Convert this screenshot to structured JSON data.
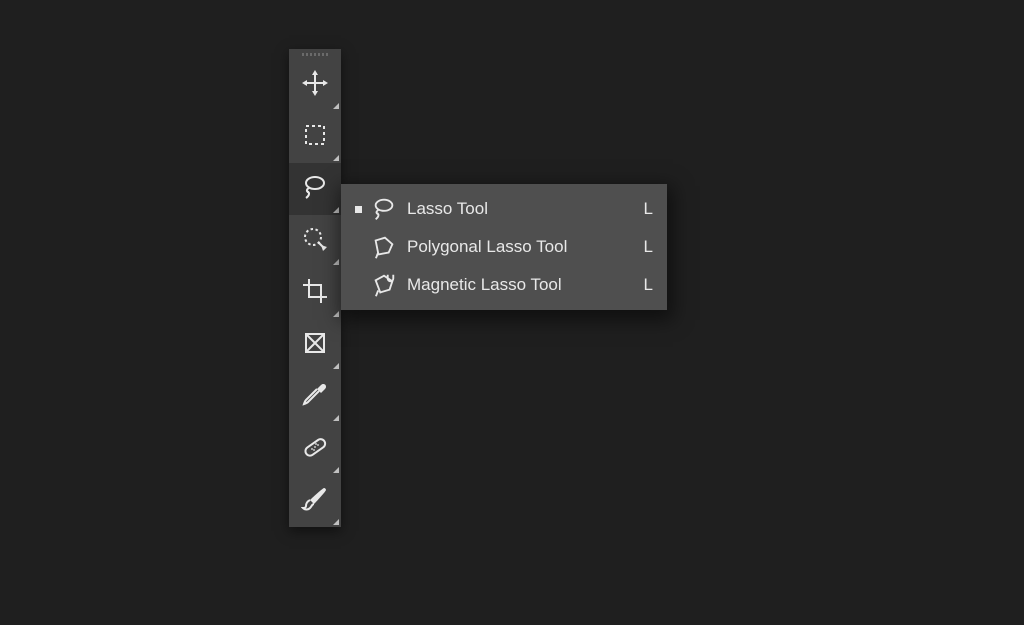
{
  "toolbar": {
    "tools": [
      {
        "id": "move",
        "has_flyout": true
      },
      {
        "id": "marquee",
        "has_flyout": true
      },
      {
        "id": "lasso",
        "has_flyout": true,
        "selected": true
      },
      {
        "id": "quick-select",
        "has_flyout": true
      },
      {
        "id": "crop",
        "has_flyout": true
      },
      {
        "id": "frame",
        "has_flyout": true
      },
      {
        "id": "eyedropper",
        "has_flyout": true
      },
      {
        "id": "spot-healing",
        "has_flyout": true
      },
      {
        "id": "brush",
        "has_flyout": true
      }
    ]
  },
  "flyout": {
    "items": [
      {
        "label": "Lasso Tool",
        "shortcut": "L",
        "active": true,
        "icon": "lasso"
      },
      {
        "label": "Polygonal Lasso Tool",
        "shortcut": "L",
        "active": false,
        "icon": "polygonal-lasso"
      },
      {
        "label": "Magnetic Lasso Tool",
        "shortcut": "L",
        "active": false,
        "icon": "magnetic-lasso"
      }
    ]
  }
}
